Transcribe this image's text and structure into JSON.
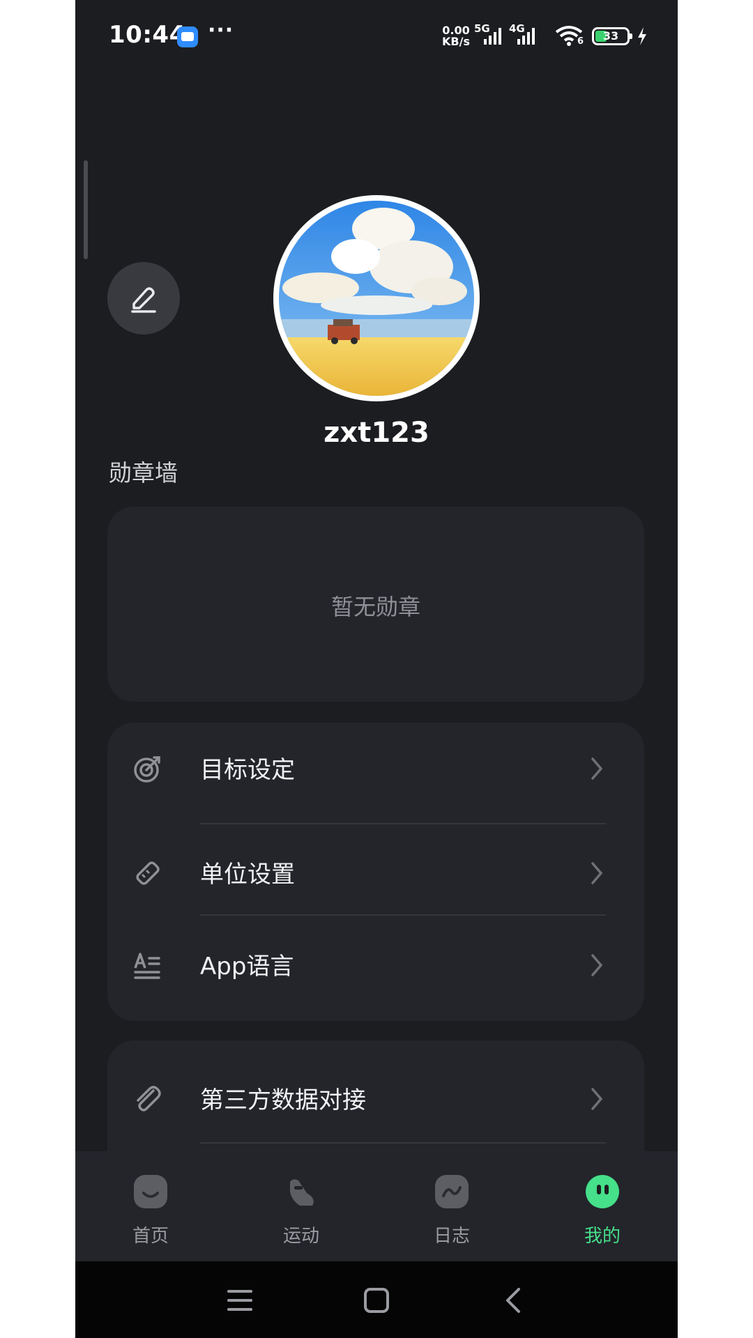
{
  "status_bar": {
    "time": "10:44",
    "more": "···",
    "net_speed_value": "0.00",
    "net_speed_unit": "KB/s",
    "net1": "5G",
    "net2": "4G",
    "wifi_tag": "6",
    "battery": "33",
    "colors": {
      "battery_fill": "#3bd16f",
      "app_icon": "#2f8cff"
    }
  },
  "profile": {
    "username": "zxt123",
    "edit_icon": "edit-pen-icon",
    "avatar": "avatar-beach-scene"
  },
  "badge_wall": {
    "title": "勋章墙",
    "empty_text": "暂无勋章"
  },
  "menu": {
    "items": [
      {
        "label": "目标设定",
        "icon": "target-icon"
      },
      {
        "label": "单位设置",
        "icon": "ruler-icon"
      },
      {
        "label": "App语言",
        "icon": "language-icon"
      }
    ]
  },
  "menu2": {
    "items": [
      {
        "label": "第三方数据对接",
        "icon": "paperclip-icon"
      }
    ]
  },
  "tabbar": {
    "tabs": [
      {
        "label": "首页",
        "icon": "home-face-icon"
      },
      {
        "label": "运动",
        "icon": "shoe-icon"
      },
      {
        "label": "日志",
        "icon": "log-wave-icon"
      },
      {
        "label": "我的",
        "icon": "me-ghost-icon",
        "active": true
      }
    ],
    "active_color": "#46df8a"
  },
  "nav": {
    "icons": [
      "menu-icon",
      "home-square-icon",
      "back-icon"
    ]
  }
}
